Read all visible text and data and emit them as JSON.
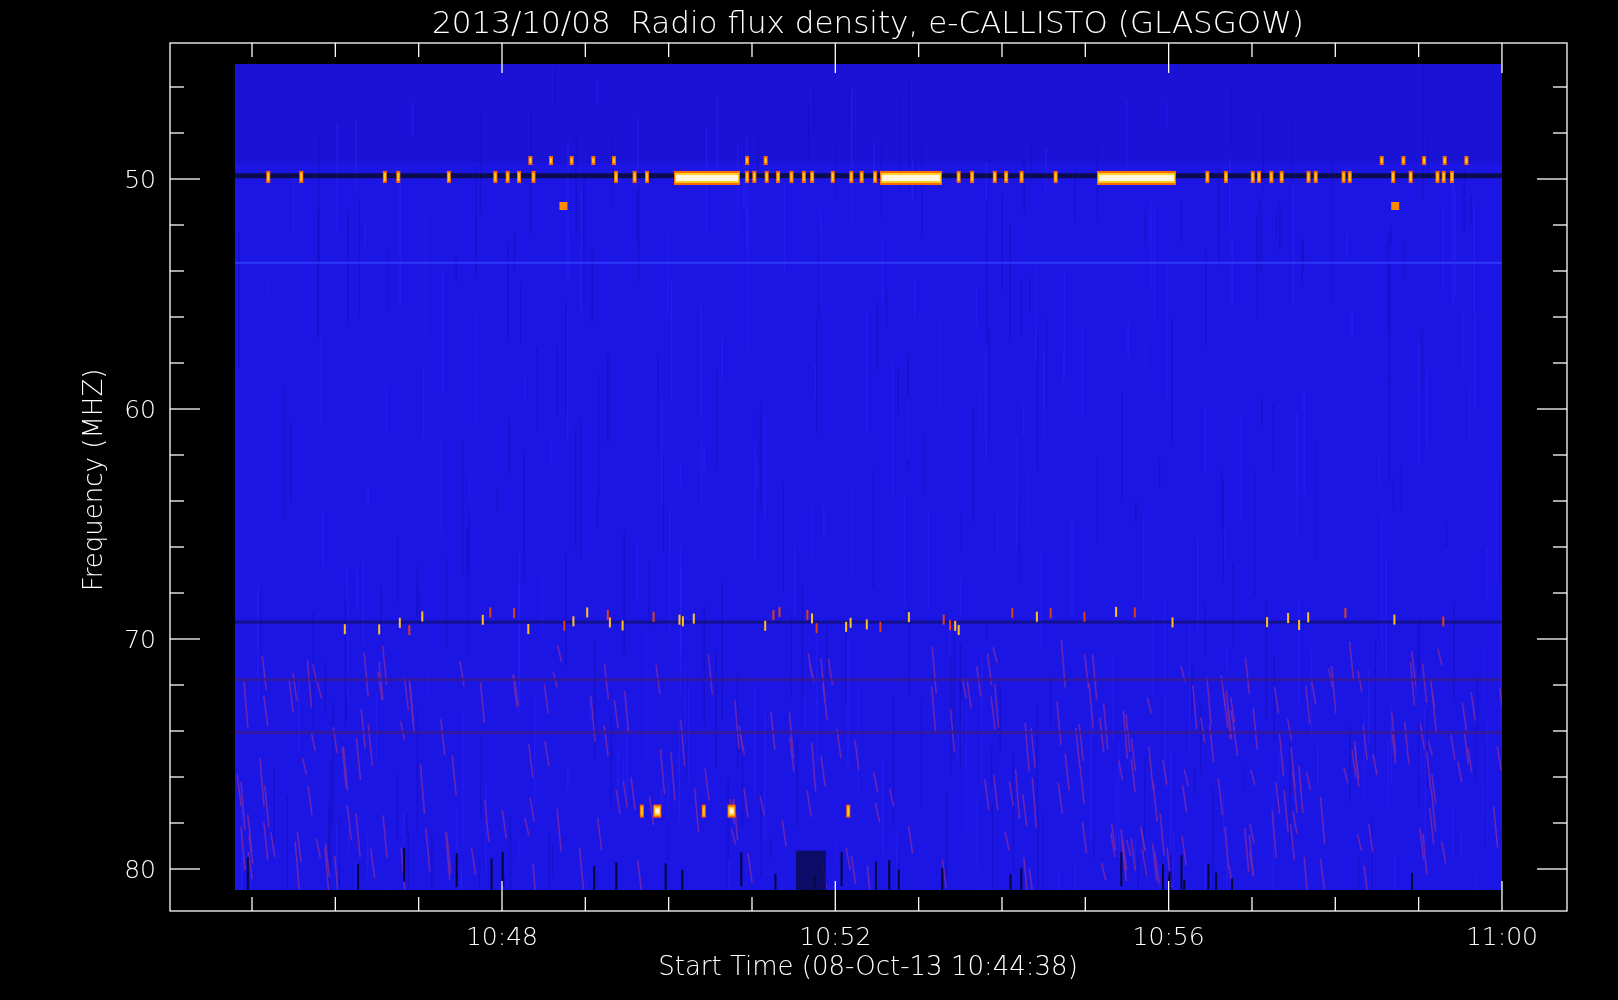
{
  "title": "2013/10/08  Radio flux density, e-CALLISTO (GLASGOW)",
  "y_axis": {
    "label": "Frequency (MHZ)",
    "ticks": [
      "50",
      "60",
      "70",
      "80"
    ]
  },
  "x_axis": {
    "label": "Start Time (08-Oct-13 10:44:38)",
    "ticks": [
      "10:48",
      "10:52",
      "10:56",
      "11:00"
    ]
  }
}
